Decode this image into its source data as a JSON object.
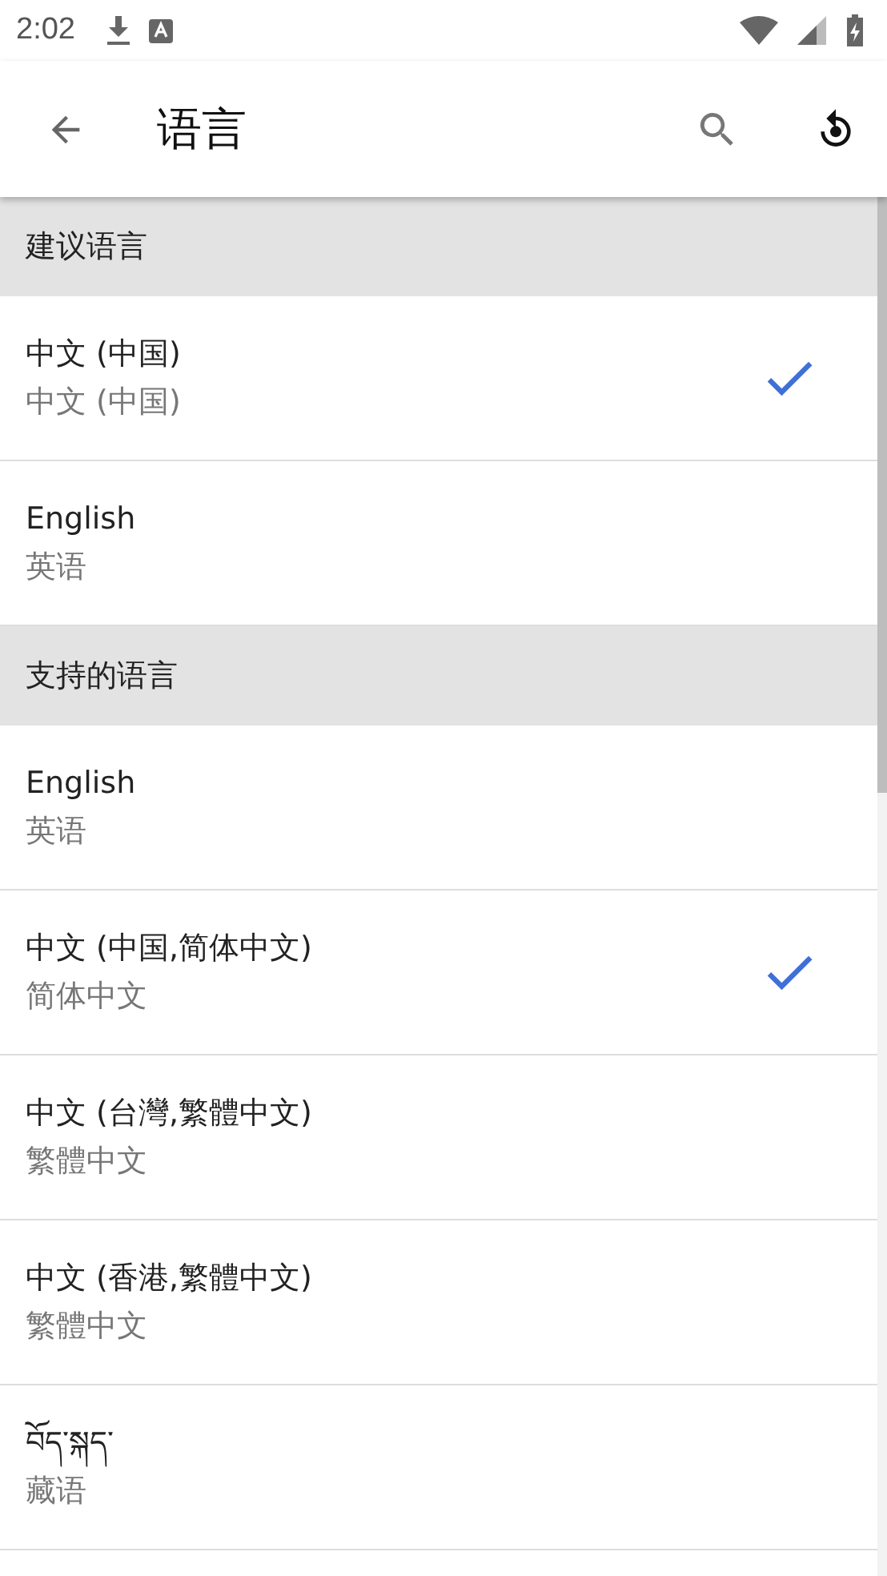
{
  "status_bar": {
    "time": "2:02"
  },
  "app_bar": {
    "title": "语言"
  },
  "sections": [
    {
      "header": "建议语言",
      "items": [
        {
          "name": "中文 (中国)",
          "subtitle": "中文 (中国)",
          "selected": true
        },
        {
          "name": "English",
          "subtitle": "英语",
          "selected": false
        }
      ]
    },
    {
      "header": "支持的语言",
      "items": [
        {
          "name": "English",
          "subtitle": "英语",
          "selected": false
        },
        {
          "name": "中文 (中国,简体中文)",
          "subtitle": "简体中文",
          "selected": true
        },
        {
          "name": "中文 (台灣,繁體中文)",
          "subtitle": "繁體中文",
          "selected": false
        },
        {
          "name": "中文 (香港,繁體中文)",
          "subtitle": "繁體中文",
          "selected": false
        },
        {
          "name": "བོད་སྐད་",
          "subtitle": "藏语",
          "selected": false
        }
      ]
    }
  ]
}
